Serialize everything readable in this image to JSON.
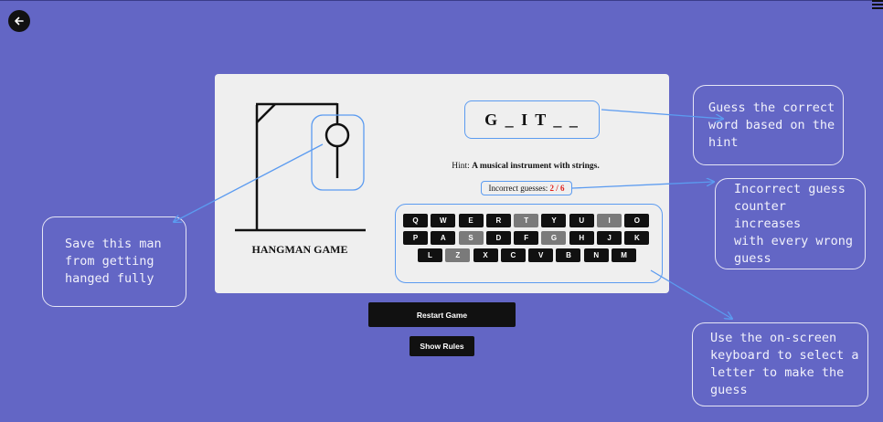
{
  "app": {
    "back_icon": "arrow-left-icon",
    "menu_icon": "hamburger-menu-icon"
  },
  "game": {
    "title": "HANGMAN GAME",
    "word_display": "G _ I T _ _",
    "hint_label": "Hint:",
    "hint_text": "A musical instrument with strings.",
    "incorrect_label": "Incorrect guesses:",
    "incorrect_count": "2 / 6",
    "incorrect_value": 2,
    "max_incorrect": 6
  },
  "keyboard": {
    "rows": [
      [
        {
          "letter": "Q",
          "used": false
        },
        {
          "letter": "W",
          "used": false
        },
        {
          "letter": "E",
          "used": false
        },
        {
          "letter": "R",
          "used": false
        },
        {
          "letter": "T",
          "used": true
        },
        {
          "letter": "Y",
          "used": false
        },
        {
          "letter": "U",
          "used": false
        },
        {
          "letter": "I",
          "used": true
        },
        {
          "letter": "O",
          "used": false
        }
      ],
      [
        {
          "letter": "P",
          "used": false
        },
        {
          "letter": "A",
          "used": false
        },
        {
          "letter": "S",
          "used": true
        },
        {
          "letter": "D",
          "used": false
        },
        {
          "letter": "F",
          "used": false
        },
        {
          "letter": "G",
          "used": true
        },
        {
          "letter": "H",
          "used": false
        },
        {
          "letter": "J",
          "used": false
        },
        {
          "letter": "K",
          "used": false
        }
      ],
      [
        {
          "letter": "L",
          "used": false
        },
        {
          "letter": "Z",
          "used": true
        },
        {
          "letter": "X",
          "used": false
        },
        {
          "letter": "C",
          "used": false
        },
        {
          "letter": "V",
          "used": false
        },
        {
          "letter": "B",
          "used": false
        },
        {
          "letter": "N",
          "used": false
        },
        {
          "letter": "M",
          "used": false
        }
      ]
    ]
  },
  "buttons": {
    "restart": "Restart Game",
    "rules": "Show Rules"
  },
  "annotations": {
    "man": "Save this man\nfrom getting\nhanged fully",
    "guess": "Guess the correct\nword based on the\nhint",
    "counter": "Incorrect guess\ncounter increases\nwith every wrong\nguess",
    "keyboard": "Use the on-screen\nkeyboard to select a\nletter to make the\nguess"
  },
  "colors": {
    "background": "#6366c5",
    "card": "#efefef",
    "annotation_blue": "#5b9bf0",
    "incorrect_red": "#e0201b",
    "key_used": "#7a7a7a"
  }
}
